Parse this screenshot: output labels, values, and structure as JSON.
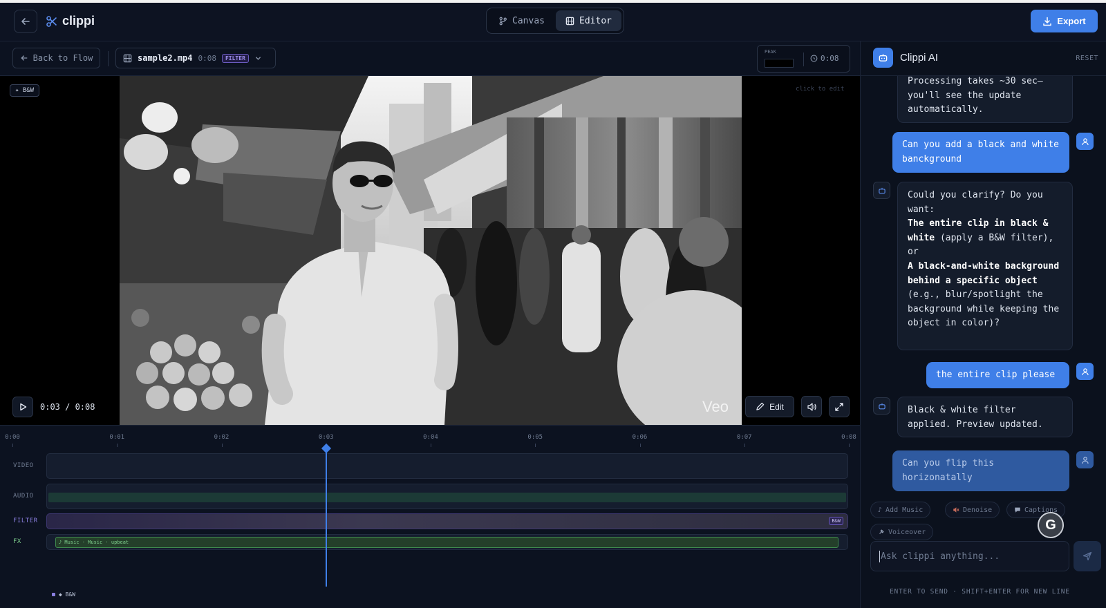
{
  "header": {
    "logo_text": "clippi",
    "mode_tabs": [
      {
        "label": "Canvas",
        "icon": "branch-icon",
        "active": false
      },
      {
        "label": "Editor",
        "icon": "film-icon",
        "active": true
      }
    ],
    "export_label": "Export"
  },
  "toolbar": {
    "back_to_flow_label": "Back to Flow",
    "file_name": "sample2.mp4",
    "file_duration": "0:08",
    "filter_badge": "FILTER",
    "peak_label": "PEAK",
    "duration_readout": "0:08"
  },
  "player": {
    "bw_tag": "✦ B&W",
    "click_to_edit": "click to edit",
    "watermark": "Veo",
    "time_readout": "0:03 / 0:08",
    "edit_label": "Edit",
    "current_time_fraction": 0.375
  },
  "timeline": {
    "ticks": [
      "0:00",
      "0:01",
      "0:02",
      "0:03",
      "0:04",
      "0:05",
      "0:06",
      "0:07",
      "0:08"
    ],
    "tracks": {
      "video": "VIDEO",
      "audio": "AUDIO",
      "filter": "FILTER",
      "fx": "FX"
    },
    "filter_chip": "B&W",
    "fx_clip_label": "♪ Music · Music · upbeat",
    "legend_label": "◆ B&W"
  },
  "assistant": {
    "title": "Clippi AI",
    "reset_label": "RESET",
    "messages": [
      {
        "role": "bot",
        "text_lines": [
          "Processing takes ~30 sec—",
          "you'll see the update",
          "automatically."
        ]
      },
      {
        "role": "user",
        "text": "Can you add a black and white banckground"
      },
      {
        "role": "bot",
        "intro": "Could you clarify? Do you want:",
        "option1_bold": "The entire clip in black & white",
        "option1_rest": " (apply a B&W filter), or",
        "option2_bold": "A black-and-white background behind a specific object",
        "option2_rest": " (e.g., blur/spotlight the background while keeping the object in color)?"
      },
      {
        "role": "user",
        "text": "the entire clip please"
      },
      {
        "role": "bot",
        "text": "Black & white filter applied. Preview updated."
      },
      {
        "role": "user",
        "text": "Can you flip this horizonatally",
        "pending": true
      }
    ],
    "quick_actions": [
      "Add Music",
      "Denoise",
      "Captions",
      "Voiceover"
    ],
    "grammarly_label": "G",
    "input_placeholder": "Ask clippi anything...",
    "hint": "ENTER TO SEND · SHIFT+ENTER FOR NEW LINE"
  },
  "colors": {
    "accent": "#3f7fe8",
    "background": "#0c1220",
    "panel": "#0b111d",
    "filter_purple": "#6b5bc0",
    "fx_green": "#3f8a4d"
  }
}
